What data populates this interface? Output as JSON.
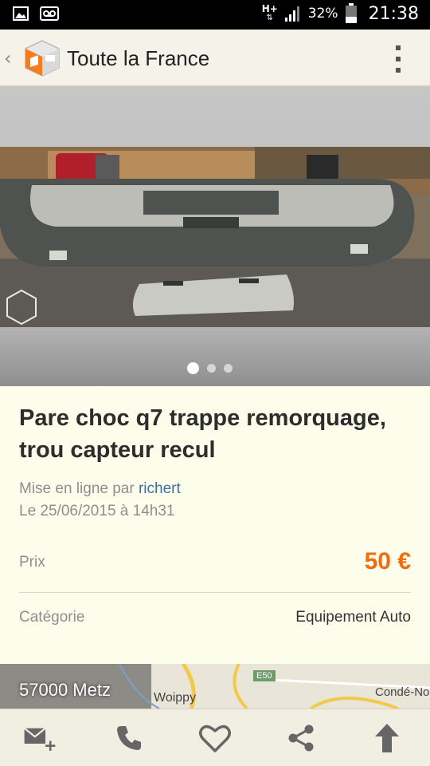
{
  "status_bar": {
    "network": "H+",
    "battery_pct": "32%",
    "time": "21:38"
  },
  "action_bar": {
    "title": "Toute la France",
    "icons": [
      "back-chevron-icon",
      "leboncoin-logo",
      "overflow-menu-icon"
    ]
  },
  "gallery": {
    "page_count": 3,
    "active_index": 0
  },
  "ad": {
    "title": "Pare choc q7 trappe remorquage, trou capteur recul",
    "posted_by_prefix": "Mise en ligne par",
    "seller": "richert",
    "date": "Le 25/06/2015 à 14h31",
    "price_label": "Prix",
    "price": "50 €",
    "category_label": "Catégorie",
    "category": "Equipement Auto"
  },
  "map": {
    "location": "57000 Metz",
    "places": [
      "Woippy",
      "Condé-No"
    ],
    "road": "E50"
  },
  "bottom_bar": {
    "icons": [
      "mail-add-icon",
      "phone-icon",
      "heart-icon",
      "share-icon",
      "upload-arrow-icon"
    ]
  },
  "colors": {
    "accent": "#f26b0f",
    "link": "#3c6fa8",
    "card_bg": "#fdfdeb"
  }
}
